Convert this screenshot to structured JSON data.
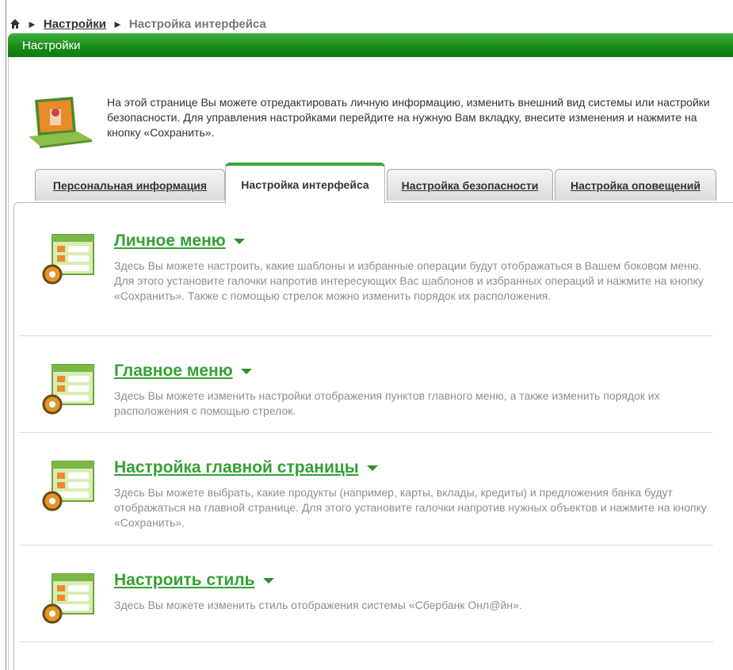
{
  "breadcrumb": {
    "home_icon": "home-icon",
    "items": [
      "Настройки",
      "Настройка интерфейса"
    ]
  },
  "header": {
    "title": "Настройки"
  },
  "intro": {
    "icon": "laptop-user-icon",
    "text": "На этой странице Вы можете отредактировать личную информацию, изменить внешний вид системы или настройки безопасности. Для управления настройками перейдите на нужную Вам вкладку, внесите изменения и нажмите на кнопку «Сохранить»."
  },
  "tabs": [
    {
      "label": "Персональная информация",
      "active": false
    },
    {
      "label": "Настройка интерфейса",
      "active": true
    },
    {
      "label": "Настройка безопасности",
      "active": false
    },
    {
      "label": "Настройка оповещений",
      "active": false
    }
  ],
  "sections": [
    {
      "title": "Личное меню",
      "description": "Здесь Вы можете настроить, какие шаблоны и избранные операции будут отображаться в Вашем боковом меню. Для этого установите галочки напротив интересующих Вас шаблонов и избранных операций и нажмите на кнопку «Сохранить». Также с помощью стрелок можно изменить порядок их расположения."
    },
    {
      "title": "Главное меню",
      "description": "Здесь Вы можете изменить настройки отображения пунктов главного меню, а также изменить порядок их расположения с помощью стрелок."
    },
    {
      "title": "Настройка главной страницы",
      "description": "Здесь Вы можете выбрать, какие продукты (например, карты, вклады, кредиты) и предложения банка будут отображаться на главной странице. Для этого установите галочки напротив нужных объектов и нажмите на кнопку «Сохранить»."
    },
    {
      "title": "Настроить стиль",
      "description": "Здесь Вы можете изменить стиль отображения системы «Сбербанк Онл@йн»."
    }
  ],
  "colors": {
    "accent": "#35a035",
    "header": "#168a16"
  }
}
